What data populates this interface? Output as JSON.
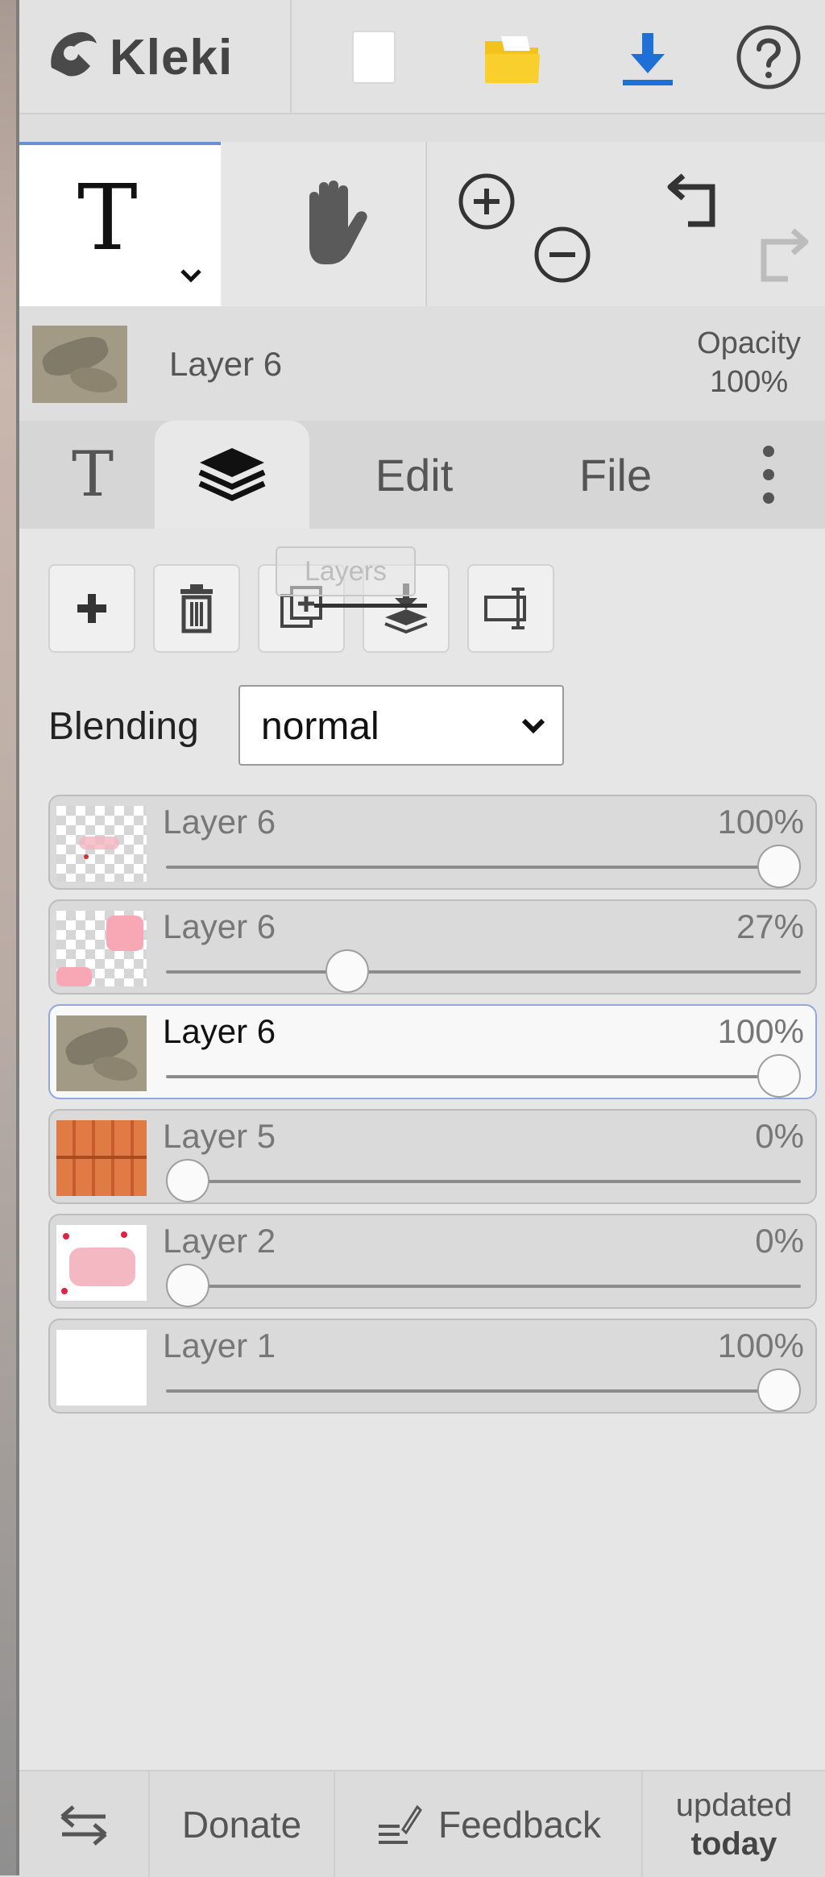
{
  "app": {
    "name": "Kleki"
  },
  "topbar": {
    "new_icon": "new-file-icon",
    "open_icon": "folder-icon",
    "save_icon": "download-icon",
    "help_icon": "help-icon",
    "colors": {
      "folder": "#f3c21b",
      "download": "#1e6fd6"
    }
  },
  "tools": {
    "text_tool": "T",
    "hand_icon": "hand-icon",
    "zoom_in_icon": "zoom-in-icon",
    "zoom_out_icon": "zoom-out-icon",
    "undo_icon": "undo-icon",
    "redo_icon": "redo-icon"
  },
  "current_layer": {
    "name": "Layer 6",
    "opacity_label": "Opacity",
    "opacity_value": "100%"
  },
  "tabs": [
    {
      "label": "T",
      "icon": "text-tab-icon"
    },
    {
      "label": "",
      "icon": "layers-icon"
    },
    {
      "label": "Edit"
    },
    {
      "label": "File"
    },
    {
      "label": "",
      "icon": "more-icon"
    }
  ],
  "layer_buttons": {
    "add_icon": "plus-icon",
    "delete_icon": "trash-icon",
    "duplicate_icon": "duplicate-icon",
    "merge_icon": "merge-down-icon",
    "rename_icon": "rename-icon",
    "tooltip": "Layers"
  },
  "blending": {
    "label": "Blending",
    "value": "normal"
  },
  "layers": [
    {
      "name": "Layer 6",
      "opacity": "100%",
      "fraction": 1.0,
      "thumb": "checker-pink",
      "selected": false
    },
    {
      "name": "Layer 6",
      "opacity": "27%",
      "fraction": 0.27,
      "thumb": "checker-pink-blobs",
      "selected": false
    },
    {
      "name": "Layer 6",
      "opacity": "100%",
      "fraction": 1.0,
      "thumb": "photo-shadows",
      "selected": true
    },
    {
      "name": "Layer 5",
      "opacity": "0%",
      "fraction": 0.0,
      "thumb": "orange-window",
      "selected": false
    },
    {
      "name": "Layer 2",
      "opacity": "0%",
      "fraction": 0.0,
      "thumb": "pink-frame",
      "selected": false
    },
    {
      "name": "Layer 1",
      "opacity": "100%",
      "fraction": 1.0,
      "thumb": "white",
      "selected": false
    }
  ],
  "footer": {
    "swap_icon": "swap-icon",
    "donate": "Donate",
    "feedback": "Feedback",
    "feedback_icon": "feedback-icon",
    "updated_line1": "updated",
    "updated_line2": "today"
  }
}
